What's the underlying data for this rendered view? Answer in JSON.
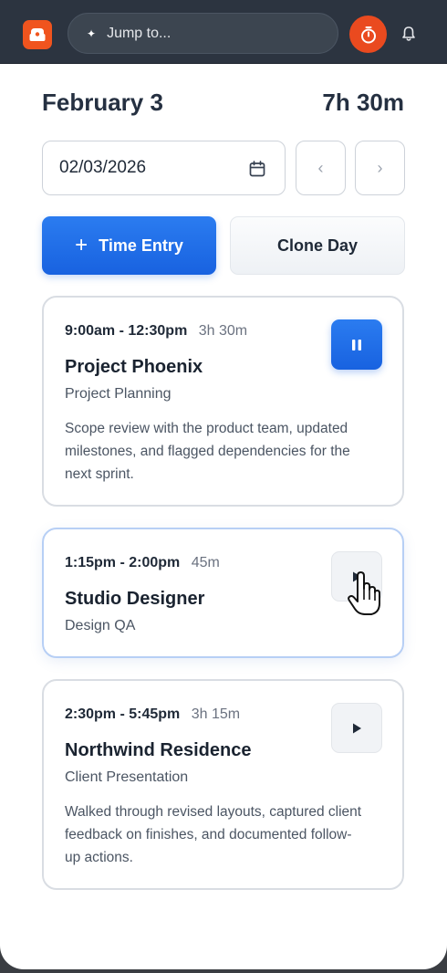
{
  "topbar": {
    "search_placeholder": "Jump to...",
    "brand_color": "#f0541e",
    "timer_color": "#ea4a1f"
  },
  "header": {
    "date_title": "February 3",
    "total_hours": "7h 30m"
  },
  "date_picker": {
    "value": "02/03/2026",
    "prev_label": "‹",
    "next_label": "›"
  },
  "actions": {
    "add_label": "Time Entry",
    "add_plus": "+",
    "clone_label": "Clone Day",
    "accent_color": "#1f6fe8"
  },
  "entries": [
    {
      "time_range": "9:00am - 12:30pm",
      "duration": "3h 30m",
      "project": "Project Phoenix",
      "task": "Project Planning",
      "description": "Scope review with the product team, updated milestones, and flagged dependencies for the next sprint.",
      "control": "pause-icon"
    },
    {
      "time_range": "1:15pm - 2:00pm",
      "duration": "45m",
      "project": "Studio Designer",
      "task": "Design QA",
      "description": "",
      "control": "play-icon"
    },
    {
      "time_range": "2:30pm - 5:45pm",
      "duration": "3h 15m",
      "project": "Northwind Residence",
      "task": "Client Presentation",
      "description": "Walked through revised layouts, captured client feedback on finishes, and documented follow-up actions.",
      "control": "play-icon"
    }
  ]
}
